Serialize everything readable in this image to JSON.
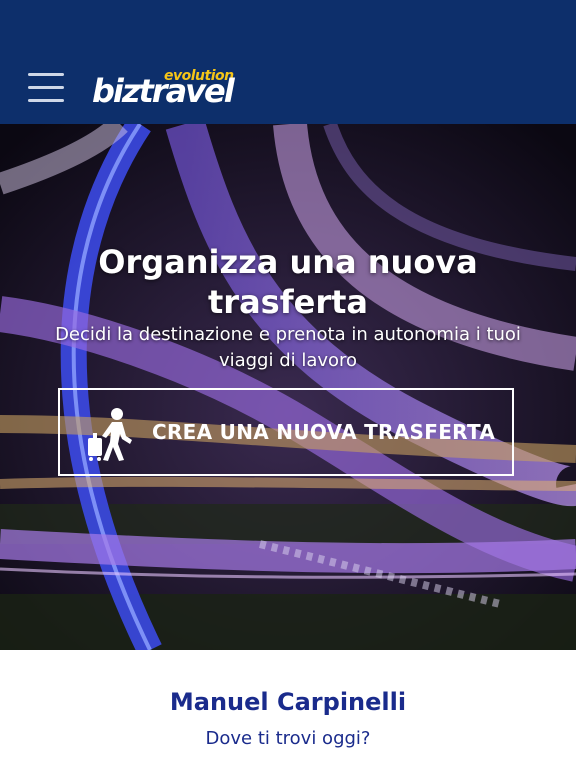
{
  "header": {
    "logo_main": "biztravel",
    "logo_sub": "evolution"
  },
  "hero": {
    "title": "Organizza una nuova trasferta",
    "subtitle": "Decidi la destinazione e prenota in autonomia i tuoi viaggi di lavoro",
    "cta_label": "CREA UNA NUOVA TRASFERTA",
    "cta_icon": "traveler-with-suitcase-icon"
  },
  "user": {
    "name": "Manuel Carpinelli",
    "question": "Dove ti trovi oggi?"
  },
  "colors": {
    "header_bg": "#0d2f6b",
    "logo_accent": "#f5c518",
    "user_text": "#1a2b8c"
  }
}
